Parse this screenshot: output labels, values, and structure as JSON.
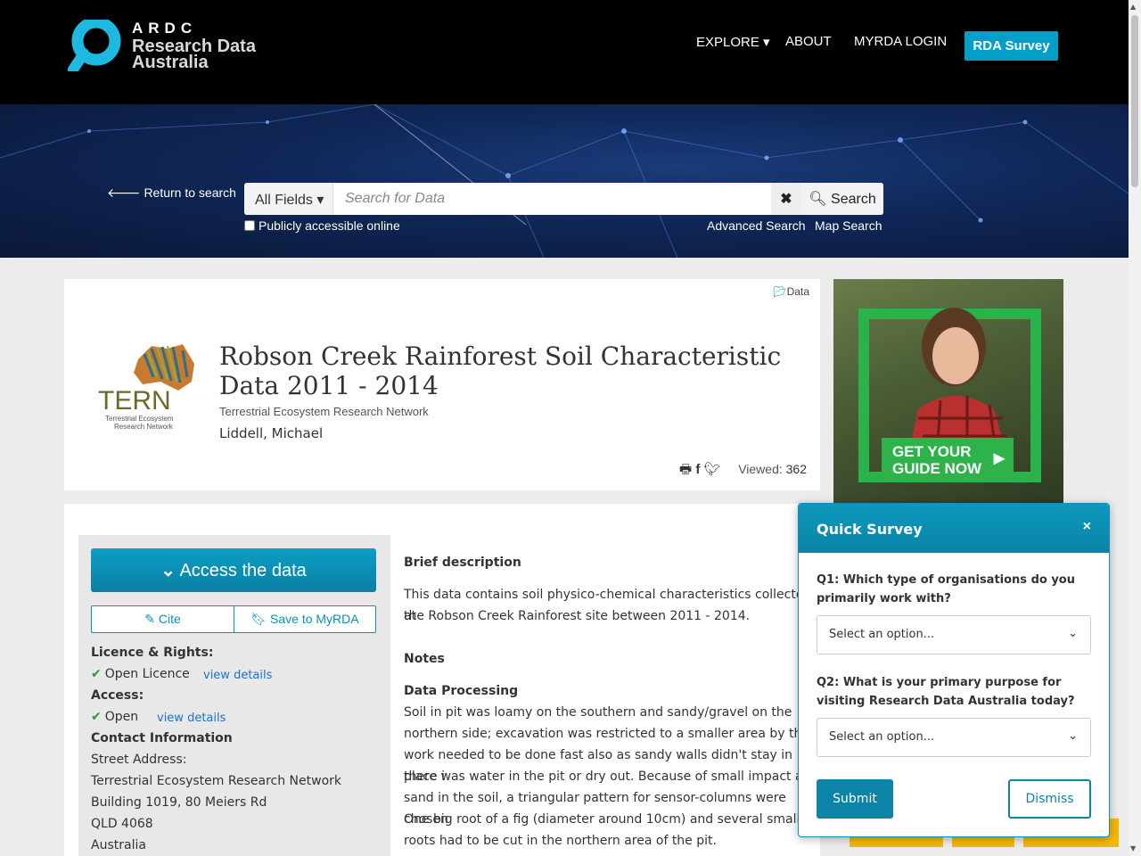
{
  "header": {
    "logo_ardc": "ARDC",
    "logo_line1": "Research Data",
    "logo_line2": "Australia",
    "nav": {
      "explore": "EXPLORE",
      "about": "ABOUT",
      "login": "MYRDA LOGIN"
    },
    "survey_button": "RDA Survey"
  },
  "search": {
    "return_link": "Return to search",
    "field_select": "All Fields",
    "placeholder": "Search for Data",
    "clear_label": "✖",
    "search_label": "Search",
    "public_checkbox_label": "Publicly accessible online",
    "advanced_link": "Advanced Search",
    "map_link": "Map Search"
  },
  "record": {
    "type": "Data",
    "title": "Robson Creek Rainforest Soil Characteristic Data 2011 - 2014",
    "org": "Terrestrial Ecosystem Research Network",
    "author": "Liddell, Michael",
    "viewed_label": "Viewed:",
    "viewed_count": "362",
    "logo_text": "TERN",
    "logo_sub1": "Terrestrial Ecosystem",
    "logo_sub2": "Research Network"
  },
  "ad": {
    "cta_line1": "GET YOUR",
    "cta_line2": "GUIDE NOW"
  },
  "sidebar": {
    "access_button": "Access the data",
    "cite_button": "Cite",
    "save_button": "Save to MyRDA",
    "licence_heading": "Licence & Rights:",
    "licence_value": "Open Licence",
    "view_details": "view details",
    "access_heading": "Access:",
    "access_value": "Open",
    "contact_heading": "Contact Information",
    "contact_lines": [
      "Street Address:",
      "Terrestrial Ecosystem Research Network",
      "Building 1019, 80 Meiers Rd",
      "QLD 4068",
      "Australia"
    ]
  },
  "main": {
    "brief_heading": "Brief description",
    "brief_lines": [
      "This data contains soil physico-chemical characteristics collected at",
      "the Robson Creek Rainforest site between 2011 - 2014."
    ],
    "notes_heading": "Notes",
    "processing_heading": "Data Processing",
    "processing_lines": [
      "Soil in pit was loamy on the southern and sandy/gravel on the",
      "northern side; excavation was restricted to a smaller area by this,",
      "work needed to be done fast also as sandy walls didn't stay in place i",
      "there was water in the pit or dry out. Because of small impact and",
      "sand in the soil, a triangular pattern for sensor-columns were chosen",
      "One big root of a fig (diameter around 10cm) and several smaller",
      "roots had to be cut in the northern area of the pit."
    ]
  },
  "survey": {
    "title": "Quick Survey",
    "close": "×",
    "q1": "Q1: Which type of organisations do you primarily work with?",
    "q1_value": "Select an option...",
    "q2": "Q2: What is your primary purpose for visiting Research Data Australia today?",
    "q2_value": "Select an option...",
    "submit": "Submit",
    "dismiss": "Dismiss"
  }
}
